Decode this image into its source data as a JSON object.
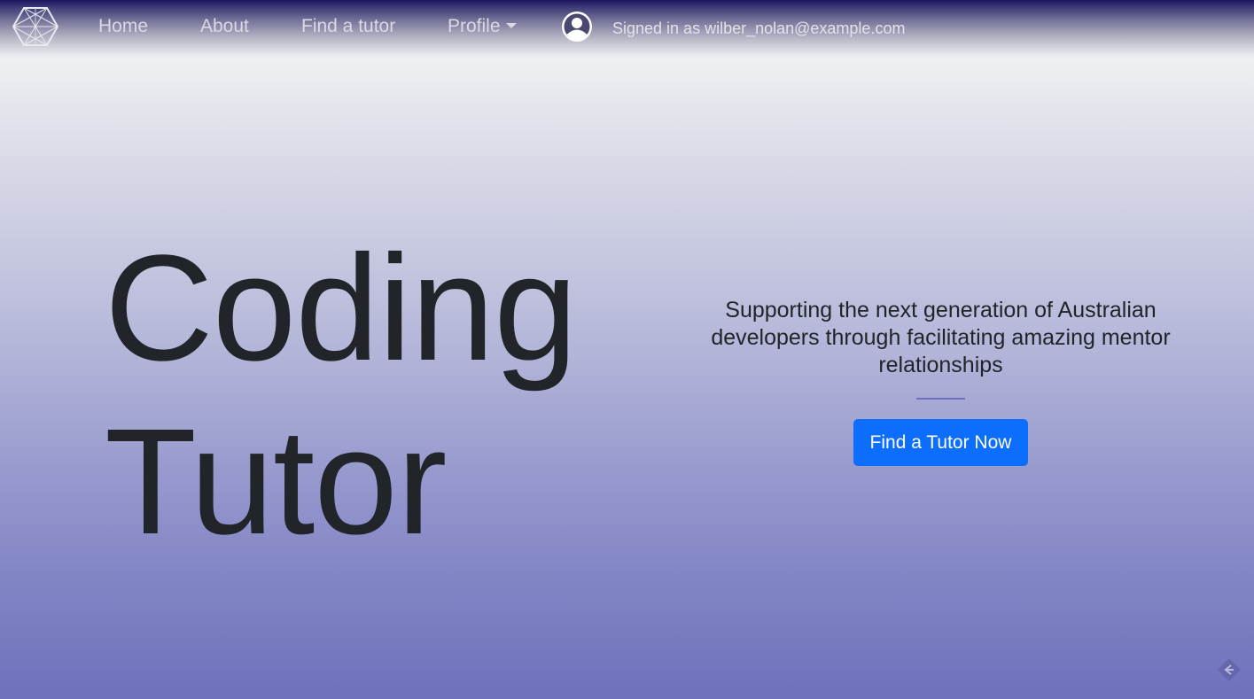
{
  "nav": {
    "logo_icon": "geometric-sphere-icon",
    "home": "Home",
    "about": "About",
    "find_tutor": "Find a tutor",
    "profile": "Profile",
    "avatar_icon": "user-circle-icon",
    "signed_in_text": "Signed in as wilber_nolan@example.com"
  },
  "hero": {
    "title_line1": "Coding",
    "title_line2": "Tutor",
    "tagline": "Supporting the next generation of Australian developers through facilitating amazing mentor relationships",
    "cta_label": "Find a Tutor Now"
  },
  "corner_icon": "diamond-arrow-icon",
  "colors": {
    "primary_button": "#0d6efd",
    "text_dark": "#212529",
    "gradient_bottom": "#6f71bb",
    "nav_top": "#1c1460"
  }
}
